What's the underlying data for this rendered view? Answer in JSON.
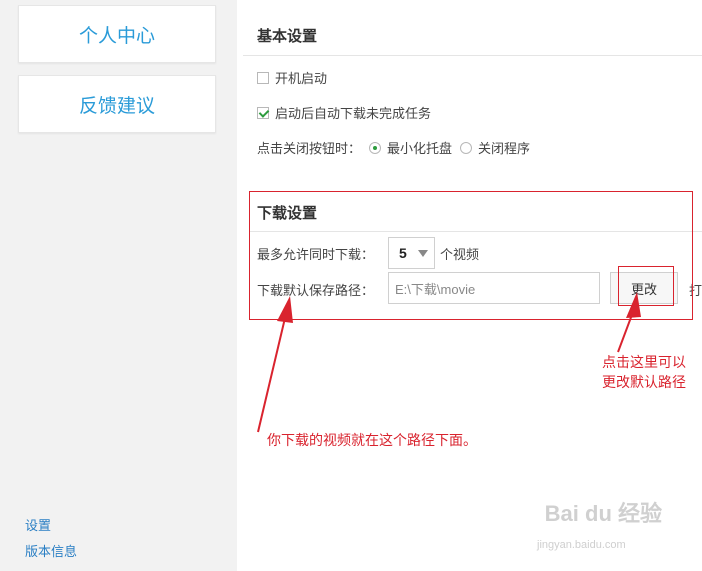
{
  "sidebar": {
    "cards": [
      {
        "label": "个人中心"
      },
      {
        "label": "反馈建议"
      }
    ],
    "links": [
      {
        "label": "设置"
      },
      {
        "label": "版本信息"
      }
    ]
  },
  "basic": {
    "title": "基本设置",
    "autostart": {
      "label": "开机启动",
      "checked": false
    },
    "resume": {
      "label": "启动后自动下载未完成任务",
      "checked": true
    },
    "close_label": "点击关闭按钮时：",
    "close_options": [
      {
        "label": "最小化托盘",
        "selected": true
      },
      {
        "label": "关闭程序",
        "selected": false
      }
    ]
  },
  "download": {
    "title": "下载设置",
    "max_label": "最多允许同时下载：",
    "max_value": "5",
    "max_unit": "个视频",
    "path_label": "下载默认保存路径：",
    "path_value": "E:\\下载\\movie",
    "change_button": "更改",
    "open_cut": "打"
  },
  "annotations": {
    "right_line1": "点击这里可以",
    "right_line2": "更改默认路径",
    "bottom": "你下载的视频就在这个路径下面。"
  },
  "watermark": {
    "logo": "Bai du 经验",
    "url": "jingyan.baidu.com"
  },
  "colors": {
    "accent": "#2a9bd8",
    "annotation_red": "#d9232e",
    "check_green": "#2e9c3e"
  }
}
